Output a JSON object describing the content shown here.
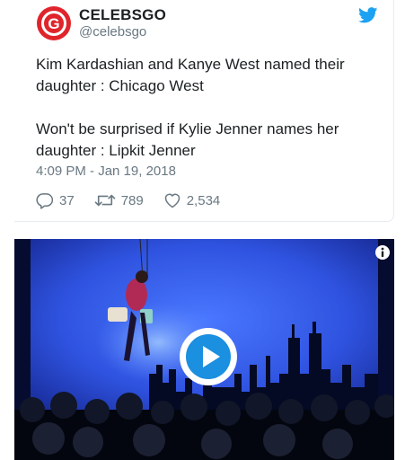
{
  "tweet": {
    "display_name": "CELEBSGO",
    "handle": "@celebsgo",
    "paragraphs": [
      "Kim Kardashian and Kanye West named their daughter : Chicago West",
      "Won't be surprised if Kylie Jenner names her daughter : Lipkit Jenner"
    ],
    "timestamp": "4:09 PM - Jan 19, 2018",
    "replies": "37",
    "retweets": "789",
    "likes": "2,534"
  },
  "colors": {
    "avatar_red": "#e0242b",
    "twitter_blue": "#1da1f2",
    "muted_text": "#697882",
    "stage_blue": "#2f53e0",
    "play_blue": "#1b8fe0"
  },
  "icons": {
    "avatar": "celebsgo-logo",
    "twitter": "twitter-bird-icon",
    "reply": "reply-icon",
    "retweet": "retweet-icon",
    "like": "heart-icon",
    "info": "info-icon",
    "play": "play-icon"
  }
}
